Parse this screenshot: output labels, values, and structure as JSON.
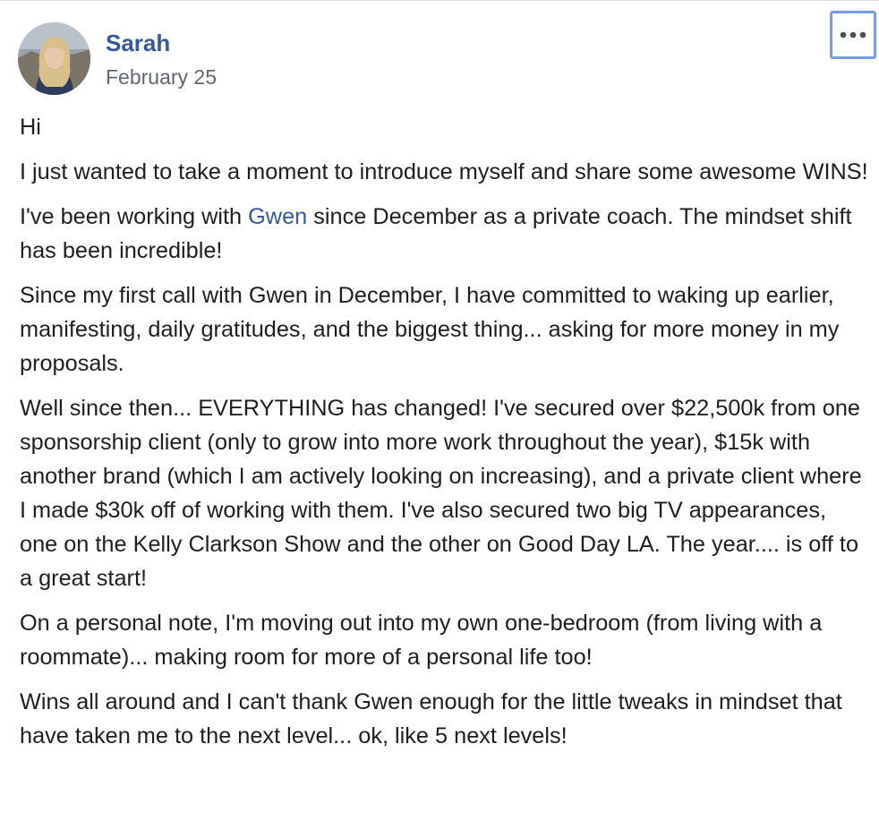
{
  "post": {
    "author": "Sarah",
    "date": "February 25",
    "more_icon": "more-horizontal-icon",
    "paragraphs": {
      "p1": "Hi",
      "p2": "I just wanted to take a moment to introduce myself and share some awesome WINS!",
      "p3_before": "I've been working with ",
      "p3_mention": "Gwen",
      "p3_after": " since December as a private coach. The mindset shift has been incredible!",
      "p4": "Since my first call with Gwen in December, I have committed to waking up earlier, manifesting, daily gratitudes, and the biggest thing... asking for more money in my proposals.",
      "p5": "Well since then... EVERYTHING has changed! I've secured over $22,500k from one sponsorship client (only to grow into more work throughout the year), $15k with another brand (which I am actively looking on increasing), and a private client where I made $30k off of working with them. I've also secured two big TV appearances, one on the Kelly Clarkson Show and the other on Good Day LA. The year.... is off to a great start!",
      "p6": "On a personal note, I'm moving out into my own one-bedroom (from living with a roommate)... making room for more of a personal life too!",
      "p7": "Wins all around and I can't thank Gwen enough for the little tweaks in mindset that have taken me to the next level... ok, like 5 next levels!"
    }
  },
  "colors": {
    "link": "#385898",
    "meta": "#606770",
    "text": "#1c1e21",
    "focus_ring": "#7a9ce8"
  }
}
